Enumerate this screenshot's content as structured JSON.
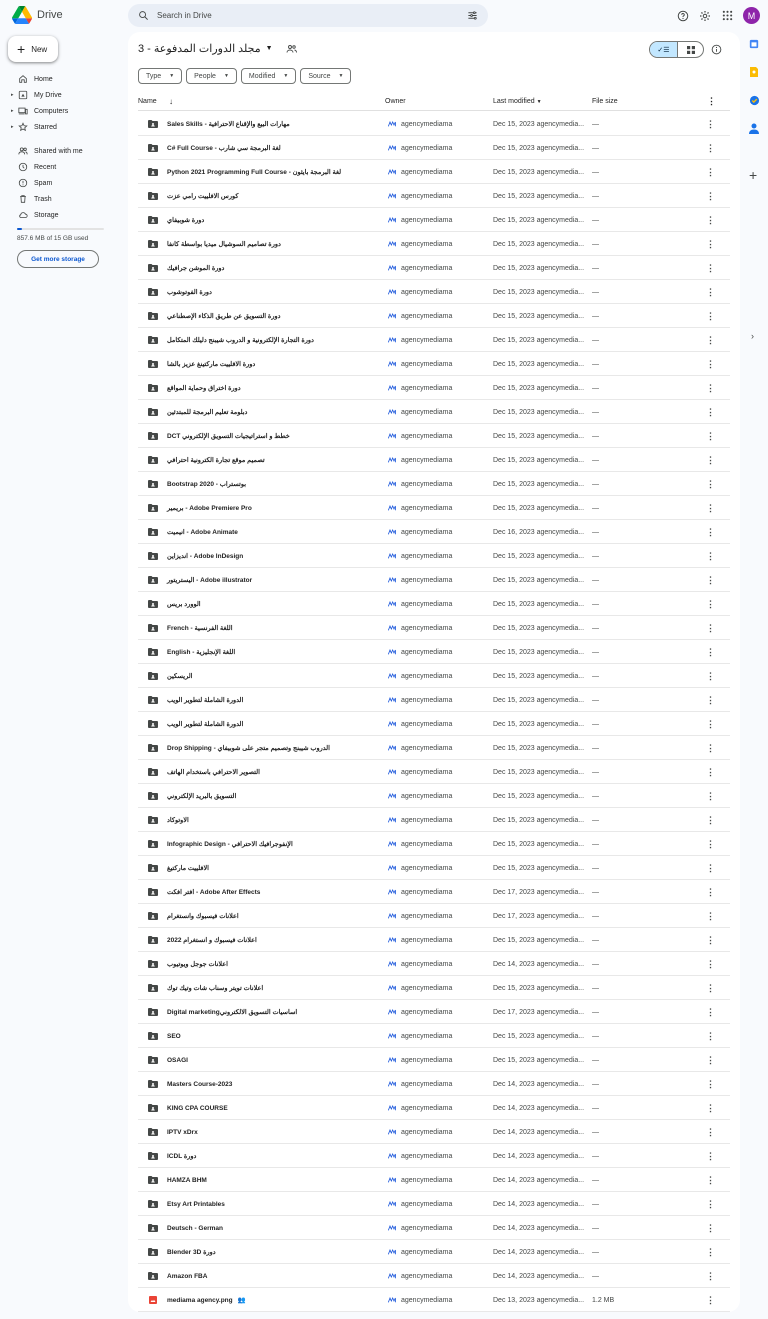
{
  "app": {
    "name": "Drive"
  },
  "search": {
    "placeholder": "Search in Drive"
  },
  "user": {
    "initial": "M",
    "avatar_color": "#8e24aa"
  },
  "sidebar": {
    "new_label": "New",
    "items": [
      {
        "label": "Home",
        "icon": "home-icon"
      },
      {
        "label": "My Drive",
        "icon": "my-drive-icon"
      },
      {
        "label": "Computers",
        "icon": "computers-icon"
      },
      {
        "label": "Starred",
        "icon": "star-icon"
      },
      {
        "label": "Shared with me",
        "icon": "people-icon"
      },
      {
        "label": "Recent",
        "icon": "clock-icon"
      },
      {
        "label": "Spam",
        "icon": "spam-icon"
      },
      {
        "label": "Trash",
        "icon": "trash-icon"
      },
      {
        "label": "Storage",
        "icon": "cloud-icon"
      }
    ],
    "storage_used_fraction": 0.057,
    "storage_text": "857.6 MB of 15 GB used",
    "get_more_storage": "Get more storage"
  },
  "folder": {
    "title": "3 - مجلد الدورات المدفوعة"
  },
  "filters": [
    "Type",
    "People",
    "Modified",
    "Source"
  ],
  "table": {
    "headers": {
      "name": "Name",
      "owner": "Owner",
      "modified": "Last modified",
      "size": "File size"
    },
    "rows": [
      {
        "name": "Sales Skills - مهارات البيع والإقناع الاحترافية",
        "owner": "agencymediama",
        "modified": "Dec 15, 2023 agencymedia...",
        "size": "—",
        "type": "folder"
      },
      {
        "name": "C# Full Course - لغة البرمجة سي شارب",
        "owner": "agencymediama",
        "modified": "Dec 15, 2023 agencymedia...",
        "size": "—",
        "type": "folder"
      },
      {
        "name": "Python 2021 Programming Full Course - لغة البرمجة بايثون",
        "owner": "agencymediama",
        "modified": "Dec 15, 2023 agencymedia...",
        "size": "—",
        "type": "folder"
      },
      {
        "name": "كورس الافلييت رامي عزت",
        "owner": "agencymediama",
        "modified": "Dec 15, 2023 agencymedia...",
        "size": "—",
        "type": "folder"
      },
      {
        "name": "دورة شوبيفاي",
        "owner": "agencymediama",
        "modified": "Dec 15, 2023 agencymedia...",
        "size": "—",
        "type": "folder"
      },
      {
        "name": "دورة تصاميم السوشيال ميديا بواسطة كانفا",
        "owner": "agencymediama",
        "modified": "Dec 15, 2023 agencymedia...",
        "size": "—",
        "type": "folder"
      },
      {
        "name": "دورة الموشن جرافيك",
        "owner": "agencymediama",
        "modified": "Dec 15, 2023 agencymedia...",
        "size": "—",
        "type": "folder"
      },
      {
        "name": "دورة الفوتوشوب",
        "owner": "agencymediama",
        "modified": "Dec 15, 2023 agencymedia...",
        "size": "—",
        "type": "folder"
      },
      {
        "name": "دورة التسويق عن طريق الذكاء الإصطناعي",
        "owner": "agencymediama",
        "modified": "Dec 15, 2023 agencymedia...",
        "size": "—",
        "type": "folder"
      },
      {
        "name": "دورة التجارة الإلكترونية و الدروب شيبنج  دليلك المتكامل",
        "owner": "agencymediama",
        "modified": "Dec 15, 2023 agencymedia...",
        "size": "—",
        "type": "folder"
      },
      {
        "name": "دورة الافلييت ماركتينغ عزيز بالشا",
        "owner": "agencymediama",
        "modified": "Dec 15, 2023 agencymedia...",
        "size": "—",
        "type": "folder"
      },
      {
        "name": "دورة اختراق وحماية المواقع",
        "owner": "agencymediama",
        "modified": "Dec 15, 2023 agencymedia...",
        "size": "—",
        "type": "folder"
      },
      {
        "name": "دبلومة تعليم البرمجة للمبتدئين",
        "owner": "agencymediama",
        "modified": "Dec 15, 2023 agencymedia...",
        "size": "—",
        "type": "folder"
      },
      {
        "name": "DCT خطط و استراتيجيات التسويق الإلكتروني",
        "owner": "agencymediama",
        "modified": "Dec 15, 2023 agencymedia...",
        "size": "—",
        "type": "folder"
      },
      {
        "name": "تصميم موقع تجارة الكترونية احترافي",
        "owner": "agencymediama",
        "modified": "Dec 15, 2023 agencymedia...",
        "size": "—",
        "type": "folder"
      },
      {
        "name": "Bootstrap 2020 - بوتستراب",
        "owner": "agencymediama",
        "modified": "Dec 15, 2023 agencymedia...",
        "size": "—",
        "type": "folder"
      },
      {
        "name": "بريمير - Adobe Premiere Pro",
        "owner": "agencymediama",
        "modified": "Dec 15, 2023 agencymedia...",
        "size": "—",
        "type": "folder"
      },
      {
        "name": "انيميت - Adobe Animate",
        "owner": "agencymediama",
        "modified": "Dec 16, 2023 agencymedia...",
        "size": "—",
        "type": "folder"
      },
      {
        "name": "انديزاين - Adobe InDesign",
        "owner": "agencymediama",
        "modified": "Dec 15, 2023 agencymedia...",
        "size": "—",
        "type": "folder"
      },
      {
        "name": "اليستريتور - Adobe illustrator",
        "owner": "agencymediama",
        "modified": "Dec 15, 2023 agencymedia...",
        "size": "—",
        "type": "folder"
      },
      {
        "name": "الوورد بريس",
        "owner": "agencymediama",
        "modified": "Dec 15, 2023 agencymedia...",
        "size": "—",
        "type": "folder"
      },
      {
        "name": "French - اللغة الفرنسية",
        "owner": "agencymediama",
        "modified": "Dec 15, 2023 agencymedia...",
        "size": "—",
        "type": "folder"
      },
      {
        "name": "English - اللغة الإنجليزية",
        "owner": "agencymediama",
        "modified": "Dec 15, 2023 agencymedia...",
        "size": "—",
        "type": "folder"
      },
      {
        "name": "الريسكين",
        "owner": "agencymediama",
        "modified": "Dec 15, 2023 agencymedia...",
        "size": "—",
        "type": "folder"
      },
      {
        "name": "الدورة الشاملة لتطوير الويب",
        "owner": "agencymediama",
        "modified": "Dec 15, 2023 agencymedia...",
        "size": "—",
        "type": "folder"
      },
      {
        "name": "الدورة الشاملة لتطوير الويب",
        "owner": "agencymediama",
        "modified": "Dec 15, 2023 agencymedia...",
        "size": "—",
        "type": "folder"
      },
      {
        "name": "Drop Shipping - الدروب شيبنج وتصميم متجر على شوبيفاي",
        "owner": "agencymediama",
        "modified": "Dec 15, 2023 agencymedia...",
        "size": "—",
        "type": "folder"
      },
      {
        "name": "التصوير الاحترافي باستخدام الهاتف",
        "owner": "agencymediama",
        "modified": "Dec 15, 2023 agencymedia...",
        "size": "—",
        "type": "folder"
      },
      {
        "name": "التسويق بالبريد الإلكتروني",
        "owner": "agencymediama",
        "modified": "Dec 15, 2023 agencymedia...",
        "size": "—",
        "type": "folder"
      },
      {
        "name": "الاوتوكاد",
        "owner": "agencymediama",
        "modified": "Dec 15, 2023 agencymedia...",
        "size": "—",
        "type": "folder"
      },
      {
        "name": "Infographic Design - الإنفوجرافيك الاحترافي",
        "owner": "agencymediama",
        "modified": "Dec 15, 2023 agencymedia...",
        "size": "—",
        "type": "folder"
      },
      {
        "name": "الافلييت ماركتيغ",
        "owner": "agencymediama",
        "modified": "Dec 15, 2023 agencymedia...",
        "size": "—",
        "type": "folder"
      },
      {
        "name": "افتر افكت - Adobe After Effects",
        "owner": "agencymediama",
        "modified": "Dec 17, 2023 agencymedia...",
        "size": "—",
        "type": "folder"
      },
      {
        "name": "اعلانات فيسبوك وانستغرام",
        "owner": "agencymediama",
        "modified": "Dec 17, 2023 agencymedia...",
        "size": "—",
        "type": "folder"
      },
      {
        "name": "2022 اعلانات فيسبوك و انستغرام",
        "owner": "agencymediama",
        "modified": "Dec 15, 2023 agencymedia...",
        "size": "—",
        "type": "folder"
      },
      {
        "name": "اعلانات جوجل ويوتيوب",
        "owner": "agencymediama",
        "modified": "Dec 14, 2023 agencymedia...",
        "size": "—",
        "type": "folder"
      },
      {
        "name": "اعلانات تويتر وسناب شات وتيك توك",
        "owner": "agencymediama",
        "modified": "Dec 15, 2023 agencymedia...",
        "size": "—",
        "type": "folder"
      },
      {
        "name": "Digital marketingاساسيات التسويق الالكتروني",
        "owner": "agencymediama",
        "modified": "Dec 17, 2023 agencymedia...",
        "size": "—",
        "type": "folder"
      },
      {
        "name": "SEO",
        "owner": "agencymediama",
        "modified": "Dec 15, 2023 agencymedia...",
        "size": "—",
        "type": "folder"
      },
      {
        "name": "OSAGI",
        "owner": "agencymediama",
        "modified": "Dec 15, 2023 agencymedia...",
        "size": "—",
        "type": "folder"
      },
      {
        "name": "Masters Course-2023",
        "owner": "agencymediama",
        "modified": "Dec 14, 2023 agencymedia...",
        "size": "—",
        "type": "folder"
      },
      {
        "name": "KING CPA COURSE",
        "owner": "agencymediama",
        "modified": "Dec 14, 2023 agencymedia...",
        "size": "—",
        "type": "folder"
      },
      {
        "name": "IPTV xDrx",
        "owner": "agencymediama",
        "modified": "Dec 14, 2023 agencymedia...",
        "size": "—",
        "type": "folder"
      },
      {
        "name": "ICDL دورة",
        "owner": "agencymediama",
        "modified": "Dec 14, 2023 agencymedia...",
        "size": "—",
        "type": "folder"
      },
      {
        "name": "HAMZA BHM",
        "owner": "agencymediama",
        "modified": "Dec 14, 2023 agencymedia...",
        "size": "—",
        "type": "folder"
      },
      {
        "name": "Etsy Art Printables",
        "owner": "agencymediama",
        "modified": "Dec 14, 2023 agencymedia...",
        "size": "—",
        "type": "folder"
      },
      {
        "name": "Deutsch - German",
        "owner": "agencymediama",
        "modified": "Dec 14, 2023 agencymedia...",
        "size": "—",
        "type": "folder"
      },
      {
        "name": "Blender 3D دورة",
        "owner": "agencymediama",
        "modified": "Dec 14, 2023 agencymedia...",
        "size": "—",
        "type": "folder"
      },
      {
        "name": "Amazon FBA",
        "owner": "agencymediama",
        "modified": "Dec 14, 2023 agencymedia...",
        "size": "—",
        "type": "folder"
      },
      {
        "name": "mediama agency.png",
        "owner": "agencymediama",
        "modified": "Dec 13, 2023 agencymedia...",
        "size": "1.2 MB",
        "type": "image"
      }
    ]
  },
  "colors": {
    "accent": "#0b57d0",
    "selected_view": "#c2e7ff",
    "folder_icon": "#444746",
    "image_icon": "#ea4335"
  }
}
